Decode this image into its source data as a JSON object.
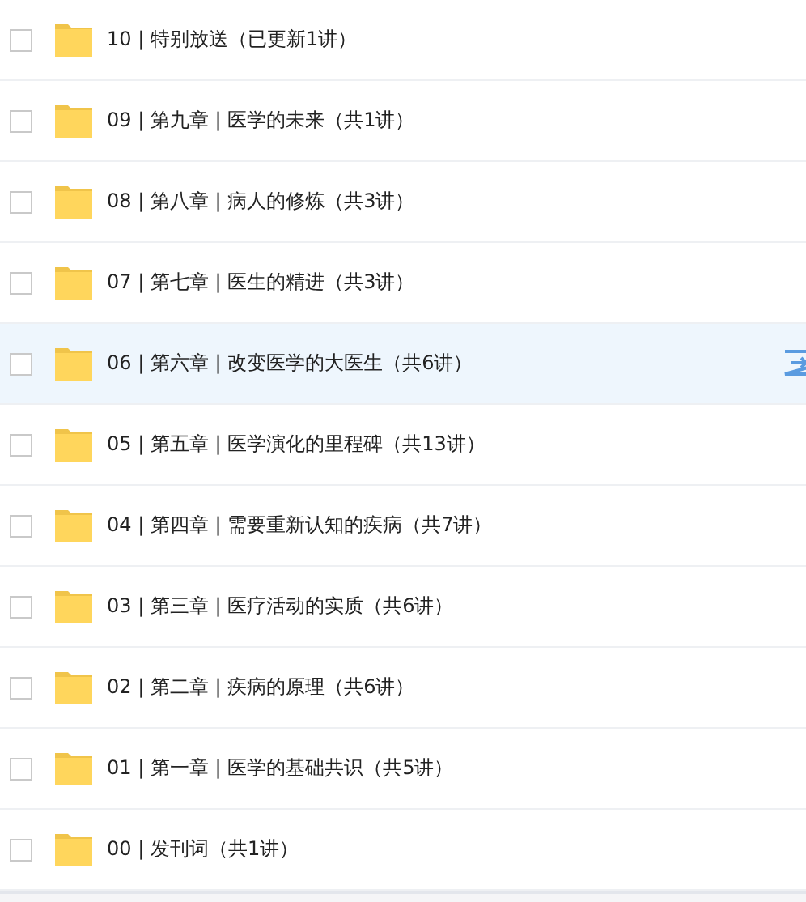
{
  "folders": [
    {
      "name": "10 | 特别放送（已更新1讲）",
      "checked": false,
      "highlighted": false
    },
    {
      "name": "09 | 第九章 | 医学的未来（共1讲）",
      "checked": false,
      "highlighted": false
    },
    {
      "name": "08 | 第八章 | 病人的修炼（共3讲）",
      "checked": false,
      "highlighted": false
    },
    {
      "name": "07 | 第七章 | 医生的精进（共3讲）",
      "checked": false,
      "highlighted": false
    },
    {
      "name": "06 | 第六章 | 改变医学的大医生（共6讲）",
      "checked": false,
      "highlighted": true
    },
    {
      "name": "05 | 第五章 | 医学演化的里程碑（共13讲）",
      "checked": false,
      "highlighted": false
    },
    {
      "name": "04 | 第四章 | 需要重新认知的疾病（共7讲）",
      "checked": false,
      "highlighted": false
    },
    {
      "name": "03 | 第三章 | 医疗活动的实质（共6讲）",
      "checked": false,
      "highlighted": false
    },
    {
      "name": "02 | 第二章 | 疾病的原理（共6讲）",
      "checked": false,
      "highlighted": false
    },
    {
      "name": "01 | 第一章 | 医学的基础共识（共5讲）",
      "checked": false,
      "highlighted": false
    },
    {
      "name": "00 | 发刊词（共1讲）",
      "checked": false,
      "highlighted": false
    }
  ]
}
